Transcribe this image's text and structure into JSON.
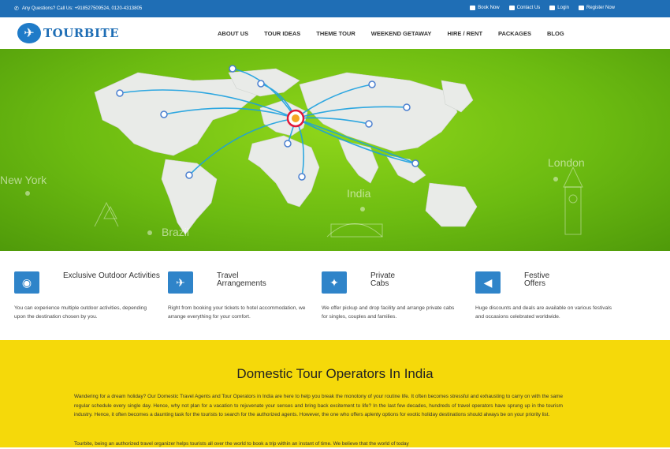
{
  "topbar": {
    "contact": "Any Questions? Call Us: +918527509524, 0120-4313805",
    "links": [
      "Book Now",
      "Contact Us",
      "Login",
      "Register Now"
    ]
  },
  "logo": {
    "text": "TOURBITE"
  },
  "nav": [
    "ABOUT US",
    "TOUR IDEAS",
    "THEME TOUR",
    "WEEKEND GETAWAY",
    "HIRE / RENT",
    "PACKAGES",
    "BLOG"
  ],
  "hero": {
    "cities": [
      "New York",
      "Brazil",
      "India",
      "London"
    ]
  },
  "features": [
    {
      "icon": "hot-air-balloon-icon",
      "title": "Exclusive Outdoor Activities",
      "desc": "You can experience multiple outdoor activities, depending upon the destination chosen by you."
    },
    {
      "icon": "airplane-icon",
      "title": "Travel Arrangements",
      "desc": "Right from booking your tickets to hotel accommodation, we arrange everything for your comfort."
    },
    {
      "icon": "compass-icon",
      "title": "Private Cabs",
      "desc": "We offer pickup and drop facility and arrange private cabs for singles, couples and families."
    },
    {
      "icon": "megaphone-icon",
      "title": "Festive Offers",
      "desc": "Huge discounts and deals are available on various festivals and occasions celebrated worldwide."
    }
  ],
  "domestic": {
    "heading": "Domestic Tour Operators In India",
    "para1": "Wandering for a dream holiday? Our Domestic Travel Agents and Tour Operators in India are here to help you break the monotony of your routine life. It often becomes stressful and exhausting to carry on with the same regular schedule every single day. Hence, why not plan for a vacation to rejuvenate your senses and bring back excitement to life? In the last few decades, hundreds of travel operators have sprung up in the tourism industry. Hence, it often becomes a daunting task for the tourists to search for the authorized agents. However, the one who offers aplenty options for exotic holiday destinations should always be on your priority list.",
    "para2": "Tourbite, being an authorized travel organizer helps tourists all over the world to book a trip within an instant of time. We believe that the world of today"
  },
  "colors": {
    "topbar": "#1f6eb5",
    "accent": "#2f84c9",
    "hero_green": "#6cbb11",
    "band_yellow": "#f5d90a"
  }
}
